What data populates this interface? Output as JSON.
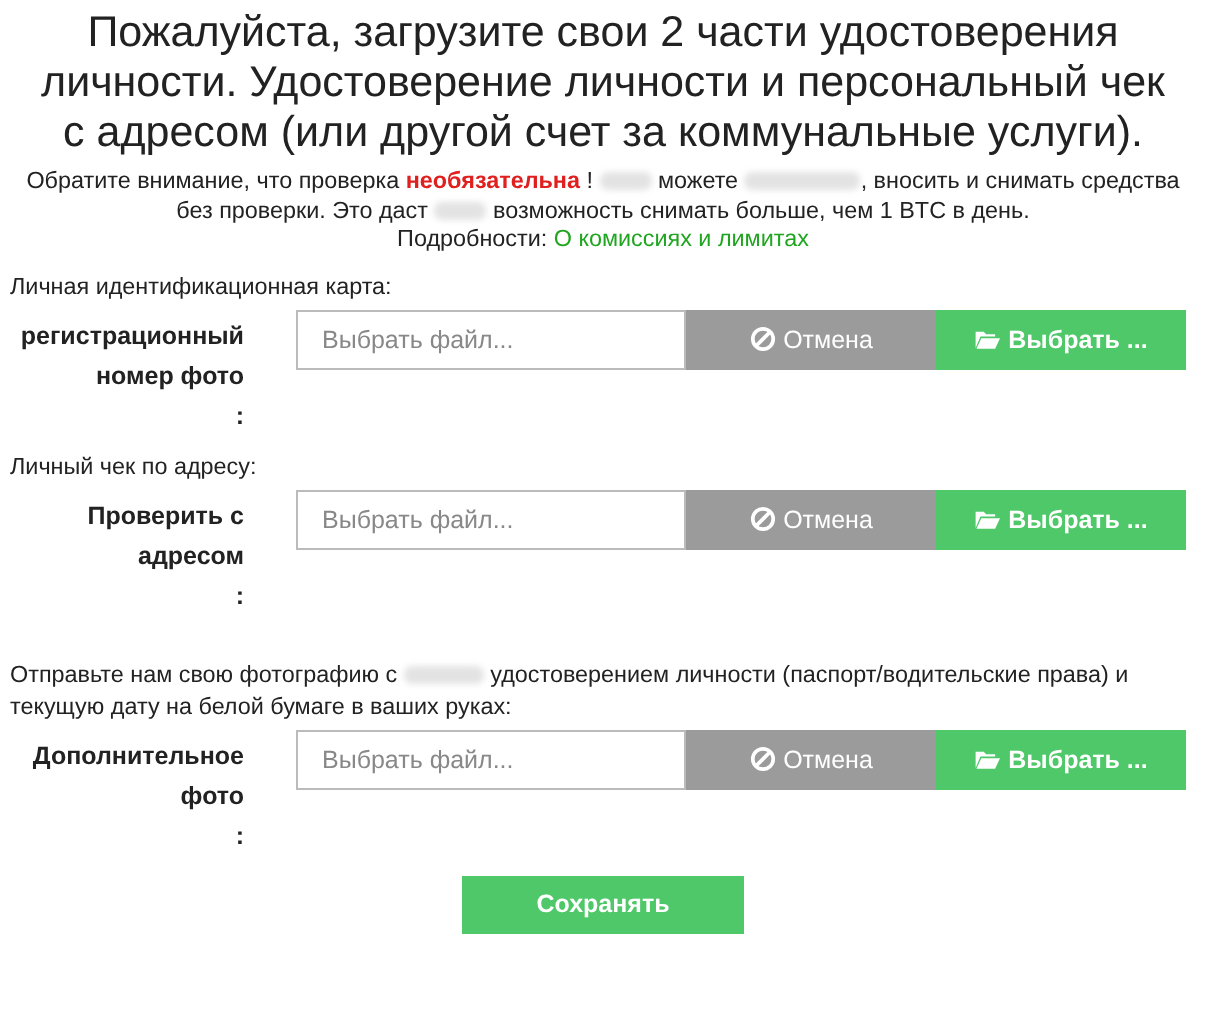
{
  "heading": "Пожалуйста, загрузите свои 2 части удостоверения личности. Удостоверение личности и персональный чек с адресом (или другой счет за коммунальные услуги).",
  "notice": [
    {
      "kind": "text",
      "text": "Обратите внимание, что проверка "
    },
    {
      "kind": "emphasis",
      "text": "необязательна"
    },
    {
      "kind": "text",
      "text": " ! "
    },
    {
      "kind": "redacted"
    },
    {
      "kind": "text",
      "text": " можете "
    },
    {
      "kind": "redacted"
    },
    {
      "kind": "text",
      "text": ", вносить и снимать средства без проверки. Это даст "
    },
    {
      "kind": "redacted"
    },
    {
      "kind": "text",
      "text": " возможность снимать больше, чем 1 BTC в день."
    },
    {
      "kind": "break"
    },
    {
      "kind": "text",
      "text": "Подробности: "
    },
    {
      "kind": "link",
      "text": "О комиссиях и лимитах"
    }
  ],
  "sections": [
    {
      "description": [
        {
          "kind": "text",
          "text": "Личная идентификационная карта:"
        }
      ],
      "label": "регистрационный номер фото",
      "colon": ":",
      "placeholder": "Выбрать файл...",
      "cancel": "Отмена",
      "browse": "Выбрать ..."
    },
    {
      "description": [
        {
          "kind": "text",
          "text": "Личный чек по адресу:"
        }
      ],
      "label": "Проверить с адресом",
      "colon": ":",
      "placeholder": "Выбрать файл...",
      "cancel": "Отмена",
      "browse": "Выбрать ..."
    },
    {
      "description": [
        {
          "kind": "text",
          "text": "Отправьте нам свою фотографию с "
        },
        {
          "kind": "redacted"
        },
        {
          "kind": "text",
          "text": " удостоверением личности (паспорт/водительские права) и текущую дату на белой бумаге в ваших руках:"
        }
      ],
      "label": "Дополнительное фото",
      "colon": ":",
      "placeholder": "Выбрать файл...",
      "cancel": "Отмена",
      "browse": "Выбрать ..."
    }
  ],
  "save": "Сохранять"
}
